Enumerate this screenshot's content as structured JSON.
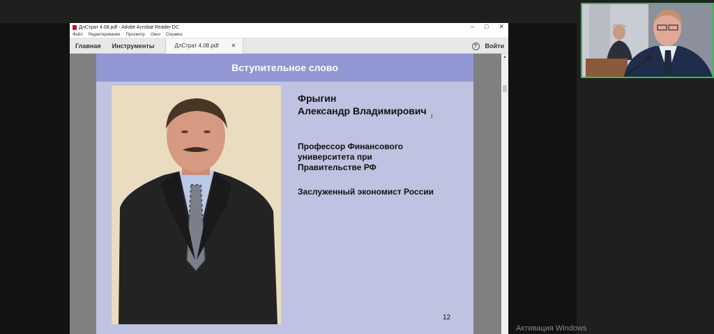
{
  "acrobat": {
    "window_title": "ДлСтрат 4.08.pdf - Adobe Acrobat Reader DC",
    "window_controls": {
      "minimize": "‒",
      "maximize": "□",
      "close": "✕"
    },
    "menu": [
      "Файл",
      "Редактирование",
      "Просмотр",
      "Окно",
      "Справка"
    ],
    "tabs": {
      "home": "Главная",
      "tools": "Инструменты"
    },
    "doc_tab": {
      "label": "ДлСтрат 4.08.pdf",
      "close": "✕"
    },
    "help": "?",
    "signin": "Войти"
  },
  "slide": {
    "header": "Вступительное слово",
    "name_line1": "Фрыгин",
    "name_line2": "Александр Владимирович",
    "role_line1": "Профессор Финансового",
    "role_line2": "университета при",
    "role_line3": "Правительстве РФ",
    "honor": "Заслуженный экономист России",
    "page_number": "12"
  },
  "os": {
    "watermark": "Активация Windows"
  },
  "colors": {
    "slide_header": "#9097d2",
    "slide_bg": "#bfc2e0",
    "active_speaker_border": "#2fc24a"
  }
}
